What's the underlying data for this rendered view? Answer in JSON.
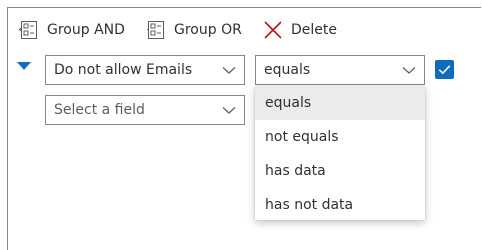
{
  "toolbar": {
    "group_and_label": "Group AND",
    "group_or_label": "Group OR",
    "delete_label": "Delete"
  },
  "row1": {
    "field_value": "Do not allow Emails",
    "operator_value": "equals",
    "checked": true
  },
  "row2": {
    "field_placeholder": "Select a field"
  },
  "operator_dropdown": {
    "options": [
      "equals",
      "not equals",
      "has data",
      "has not data"
    ],
    "selected_index": 0
  },
  "colors": {
    "accent": "#0f6cbd",
    "delete_icon": "#c50f1f",
    "selected_option_bg": "#edebe9"
  }
}
